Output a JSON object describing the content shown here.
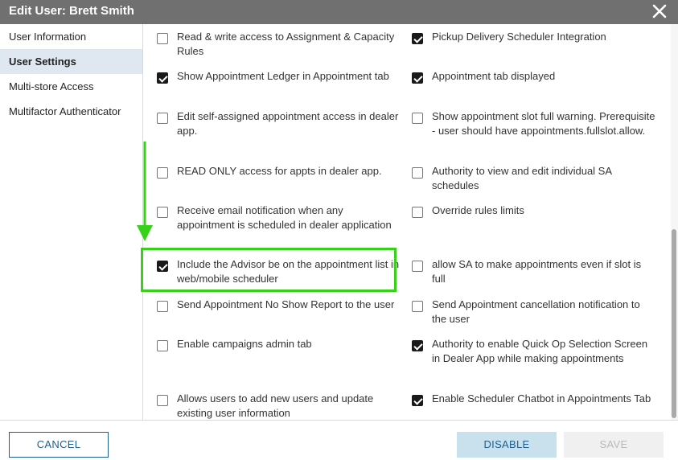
{
  "dialog": {
    "title": "Edit User: Brett Smith",
    "close_icon": "close-icon"
  },
  "sidebar": {
    "items": [
      {
        "label": "User Information",
        "active": false
      },
      {
        "label": "User Settings",
        "active": true
      },
      {
        "label": "Multi-store Access",
        "active": false
      },
      {
        "label": "Multifactor Authenticator",
        "active": false
      }
    ]
  },
  "settings": {
    "left": [
      {
        "label": "Read & write access to Assignment & Capacity Rules",
        "checked": false
      },
      {
        "label": "Show Appointment Ledger in Appointment tab",
        "checked": true
      },
      {
        "label": "Edit self-assigned appointment access in dealer app.",
        "checked": false
      },
      {
        "label": "READ ONLY access for appts in dealer app.",
        "checked": false
      },
      {
        "label": "Receive email notification when any appointment is scheduled in dealer application",
        "checked": false
      },
      {
        "label": "Include the Advisor be on the appointment list in web/mobile scheduler",
        "checked": true
      },
      {
        "label": "Send Appointment No Show Report to the user",
        "checked": false
      },
      {
        "label": "Enable campaigns admin tab",
        "checked": false
      },
      {
        "label": "Allows users to add new users and update existing user information",
        "checked": false
      }
    ],
    "right": [
      {
        "label": "Pickup Delivery Scheduler Integration",
        "checked": true
      },
      {
        "label": "Appointment tab displayed",
        "checked": true
      },
      {
        "label": "Show appointment slot full warning. Prerequisite - user should have appointments.fullslot.allow.",
        "checked": false
      },
      {
        "label": "Authority to view and edit individual SA schedules",
        "checked": false
      },
      {
        "label": "Override rules limits",
        "checked": false
      },
      {
        "label": "allow SA to make appointments even if slot is full",
        "checked": false
      },
      {
        "label": "Send Appointment cancellation notification to the user",
        "checked": false
      },
      {
        "label": "Authority to enable Quick Op Selection Screen in Dealer App while making appointments",
        "checked": true
      },
      {
        "label": "Enable Scheduler Chatbot in Appointments Tab",
        "checked": true
      }
    ]
  },
  "annotation": {
    "color": "#38d11a"
  },
  "footer": {
    "cancel_label": "CANCEL",
    "disable_label": "DISABLE",
    "save_label": "SAVE"
  },
  "colors": {
    "titlebar": "#707070",
    "active_nav": "#dfe8f0",
    "primary": "#1d5f8f",
    "disable_bg": "#c9e0ed"
  }
}
